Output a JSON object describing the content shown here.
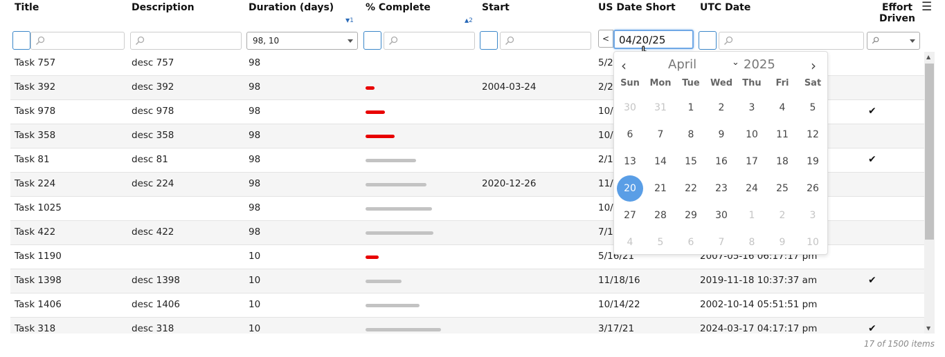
{
  "columns": {
    "title": "Title",
    "description": "Description",
    "duration": "Duration (days)",
    "percent_complete": "% Complete",
    "start": "Start",
    "us_date_short": "US Date Short",
    "utc_date": "UTC Date",
    "effort_driven_1": "Effort",
    "effort_driven_2": "Driven"
  },
  "sort": {
    "duration_order": "1",
    "percent_order": "2"
  },
  "filters": {
    "duration_value": "98, 10",
    "date_value": "04/20/25",
    "date_operator": "<"
  },
  "colors": {
    "bar_red": "#e80000",
    "bar_gray": "#c3c3c3",
    "accent": "#5a9ee6"
  },
  "rows": [
    {
      "title": "Task 757",
      "desc": "desc 757",
      "duration": "98",
      "percent": 0,
      "bar": "none",
      "start": "",
      "us_date": "5/24",
      "utc": "",
      "effort": false
    },
    {
      "title": "Task 392",
      "desc": "desc 392",
      "duration": "98",
      "percent": 12,
      "bar": "red",
      "start": "2004-03-24",
      "us_date": "2/24",
      "utc": "",
      "effort": false
    },
    {
      "title": "Task 978",
      "desc": "desc 978",
      "duration": "98",
      "percent": 25,
      "bar": "red",
      "start": "",
      "us_date": "10/",
      "utc": "",
      "effort": true
    },
    {
      "title": "Task 358",
      "desc": "desc 358",
      "duration": "98",
      "percent": 38,
      "bar": "red",
      "start": "",
      "us_date": "10/",
      "utc": "",
      "effort": false
    },
    {
      "title": "Task 81",
      "desc": "desc 81",
      "duration": "98",
      "percent": 66,
      "bar": "gray",
      "start": "",
      "us_date": "2/16",
      "utc": "",
      "effort": true
    },
    {
      "title": "Task 224",
      "desc": "desc 224",
      "duration": "98",
      "percent": 80,
      "bar": "gray",
      "start": "2020-12-26",
      "us_date": "11/",
      "utc": "",
      "effort": false
    },
    {
      "title": "Task 1025",
      "desc": "",
      "duration": "98",
      "percent": 87,
      "bar": "gray",
      "start": "",
      "us_date": "10/",
      "utc": "",
      "effort": false
    },
    {
      "title": "Task 422",
      "desc": "desc 422",
      "duration": "98",
      "percent": 89,
      "bar": "gray",
      "start": "",
      "us_date": "7/19",
      "utc": "",
      "effort": false
    },
    {
      "title": "Task 1190",
      "desc": "",
      "duration": "10",
      "percent": 17,
      "bar": "red",
      "start": "",
      "us_date": "5/16/21",
      "utc": "2007-05-16 06:17:17 pm",
      "effort": false
    },
    {
      "title": "Task 1398",
      "desc": "desc 1398",
      "duration": "10",
      "percent": 47,
      "bar": "gray",
      "start": "",
      "us_date": "11/18/16",
      "utc": "2019-11-18 10:37:37 am",
      "effort": true
    },
    {
      "title": "Task 1406",
      "desc": "desc 1406",
      "duration": "10",
      "percent": 71,
      "bar": "gray",
      "start": "",
      "us_date": "10/14/22",
      "utc": "2002-10-14 05:51:51 pm",
      "effort": false
    },
    {
      "title": "Task 318",
      "desc": "desc 318",
      "duration": "10",
      "percent": 99,
      "bar": "gray",
      "start": "",
      "us_date": "3/17/21",
      "utc": "2024-03-17 04:17:17 pm",
      "effort": true
    }
  ],
  "footer": "17 of 1500 items",
  "picker": {
    "month": "April",
    "year": "2025",
    "weekdays": [
      "Sun",
      "Mon",
      "Tue",
      "Wed",
      "Thu",
      "Fri",
      "Sat"
    ],
    "days": [
      [
        "30",
        "31",
        "1",
        "2",
        "3",
        "4",
        "5"
      ],
      [
        "6",
        "7",
        "8",
        "9",
        "10",
        "11",
        "12"
      ],
      [
        "13",
        "14",
        "15",
        "16",
        "17",
        "18",
        "19"
      ],
      [
        "20",
        "21",
        "22",
        "23",
        "24",
        "25",
        "26"
      ],
      [
        "27",
        "28",
        "29",
        "30",
        "1",
        "2",
        "3"
      ],
      [
        "4",
        "5",
        "6",
        "7",
        "8",
        "9",
        "10"
      ]
    ],
    "selected_day": "20"
  },
  "icons": {
    "menu": "hamburger-icon",
    "search": "search-icon",
    "check": "checkmark-icon"
  }
}
